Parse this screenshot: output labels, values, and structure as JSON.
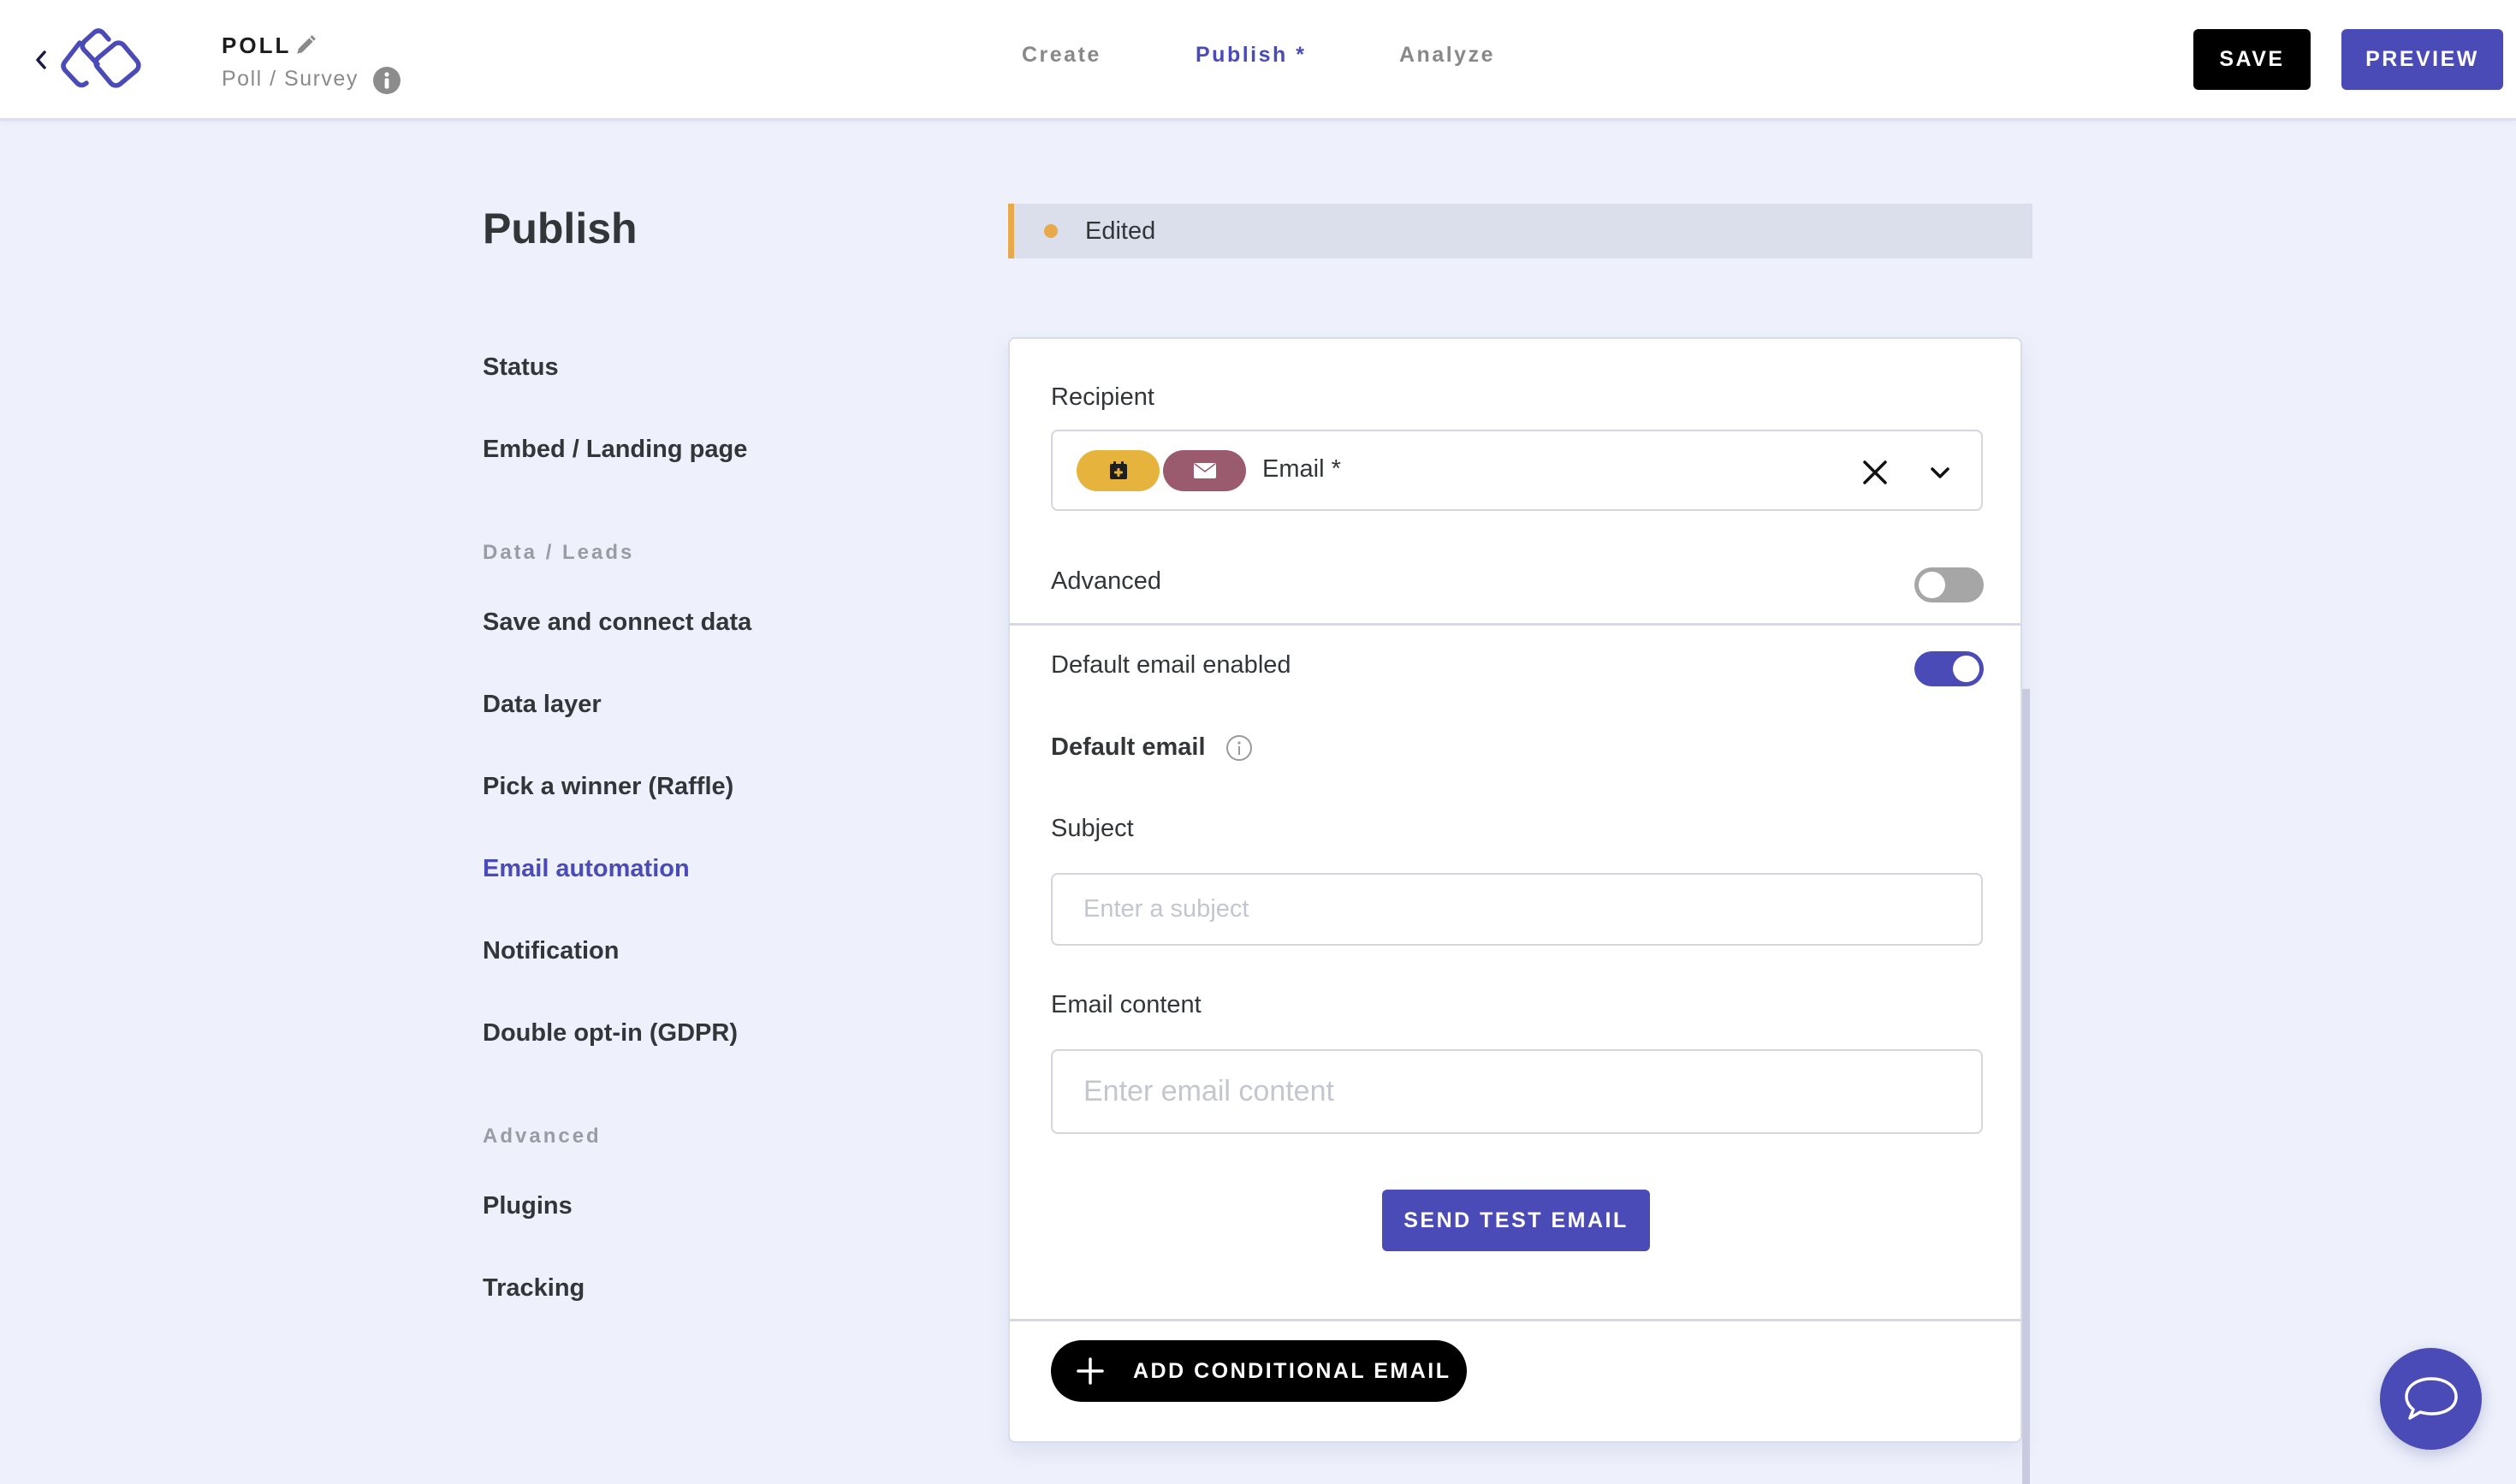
{
  "header": {
    "title": "POLL",
    "subtitle": "Poll / Survey",
    "tabs": [
      {
        "label": "Create",
        "active": false
      },
      {
        "label": "Publish *",
        "active": true
      },
      {
        "label": "Analyze",
        "active": false
      }
    ],
    "save_label": "SAVE",
    "preview_label": "PREVIEW"
  },
  "page": {
    "title": "Publish",
    "status_banner": "Edited"
  },
  "sidebar": {
    "items": [
      {
        "label": "Status"
      },
      {
        "label": "Embed / Landing page"
      }
    ],
    "sections": [
      {
        "heading": "Data / Leads",
        "items": [
          {
            "label": "Save and connect data"
          },
          {
            "label": "Data layer"
          },
          {
            "label": "Pick a winner (Raffle)"
          },
          {
            "label": "Email automation",
            "active": true
          },
          {
            "label": "Notification"
          },
          {
            "label": "Double opt-in (GDPR)"
          }
        ]
      },
      {
        "heading": "Advanced",
        "items": [
          {
            "label": "Plugins"
          },
          {
            "label": "Tracking"
          }
        ]
      }
    ]
  },
  "email_form": {
    "recipient_label": "Recipient",
    "recipient_value": "Email *",
    "recipient_chip_icons": [
      "calendar-plus-icon",
      "mail-icon"
    ],
    "advanced_label": "Advanced",
    "advanced_enabled": false,
    "default_email_enabled_label": "Default email enabled",
    "default_email_enabled": true,
    "default_email_heading": "Default email",
    "subject_label": "Subject",
    "subject_value": "",
    "subject_placeholder": "Enter a subject",
    "content_label": "Email content",
    "content_value": "",
    "content_placeholder": "Enter email content",
    "send_test_label": "SEND TEST EMAIL",
    "add_conditional_label": "ADD CONDITIONAL EMAIL"
  },
  "colors": {
    "accent": "#4b4bb8",
    "edited_status": "#e8a84c",
    "chip_yellow": "#e6b43c",
    "chip_mauve": "#9a5b6e",
    "background": "#eef1fb"
  }
}
